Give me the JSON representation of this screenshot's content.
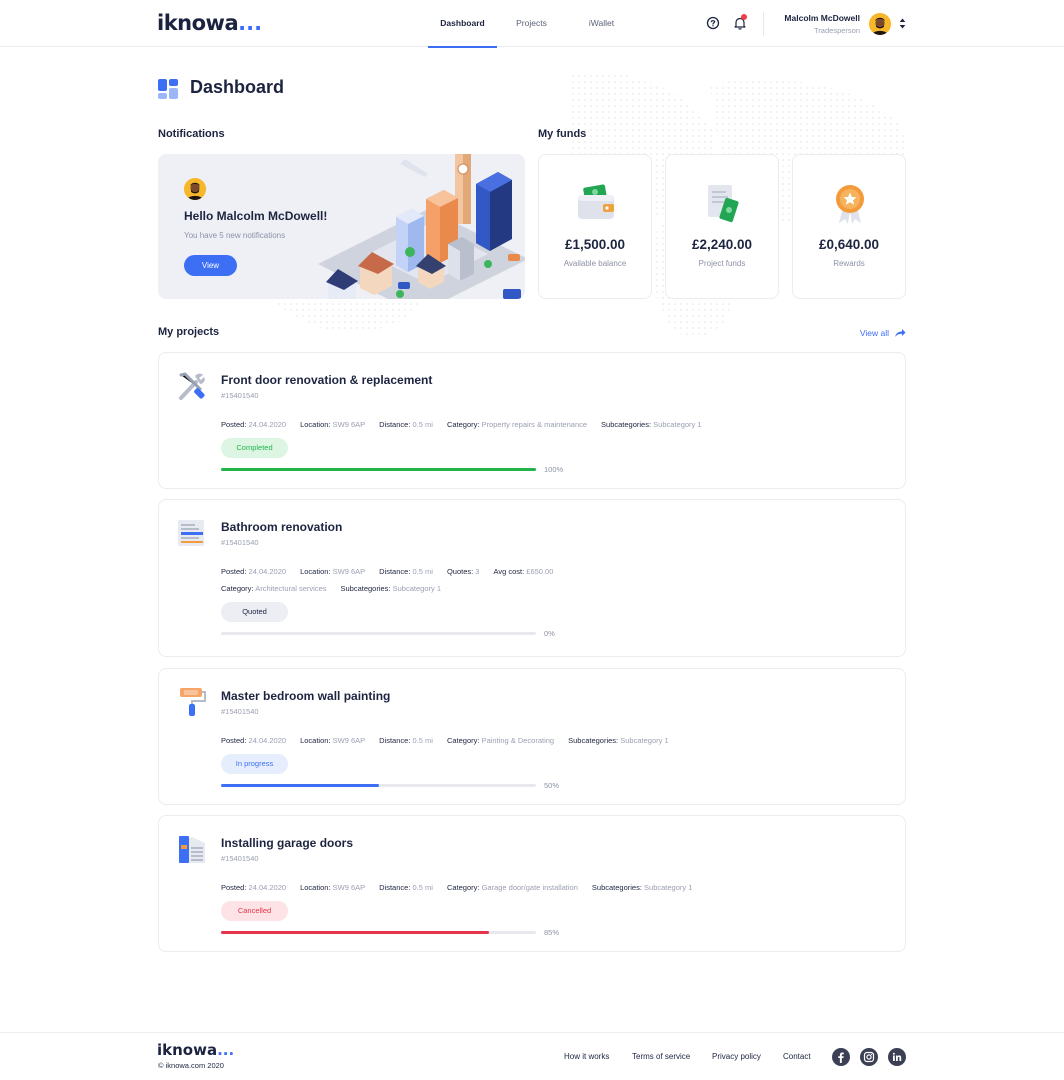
{
  "brand": {
    "name": "iknowa",
    "dots": "..."
  },
  "nav": {
    "tabs": [
      {
        "label": "Dashboard",
        "active": true
      },
      {
        "label": "Projects",
        "active": false
      },
      {
        "label": "iWallet",
        "active": false
      }
    ]
  },
  "user": {
    "name": "Malcolm McDowell",
    "role": "Tradesperson"
  },
  "page": {
    "title": "Dashboard"
  },
  "notifications": {
    "section_title": "Notifications",
    "greeting": "Hello Malcolm McDowell!",
    "subtitle": "You have 5 new notifications",
    "button_label": "View"
  },
  "funds": {
    "section_title": "My funds",
    "items": [
      {
        "amount": "£1,500.00",
        "label": "Available balance",
        "icon": "wallet-icon"
      },
      {
        "amount": "£2,240.00",
        "label": "Project funds",
        "icon": "document-money-icon"
      },
      {
        "amount": "£0,640.00",
        "label": "Rewards",
        "icon": "medal-icon"
      }
    ]
  },
  "projects": {
    "section_title": "My projects",
    "view_all": "View all",
    "items": [
      {
        "title": "Front door renovation & replacement",
        "id": "#15401540",
        "icon": "tools-icon",
        "meta_rows": [
          [
            {
              "k": "Posted:",
              "v": "24.04.2020"
            },
            {
              "k": "Location:",
              "v": "SW9 6AP"
            },
            {
              "k": "Distance:",
              "v": "0.5 mi"
            },
            {
              "k": "Category:",
              "v": "Property repairs & maintenance"
            },
            {
              "k": "Subcategories:",
              "v": "Subcategory 1"
            }
          ]
        ],
        "status": "Completed",
        "status_color": "#24b34b",
        "status_bg": "#dcf6e3",
        "progress": 100,
        "progress_label": "100%"
      },
      {
        "title": "Bathroom renovation",
        "id": "#15401540",
        "icon": "document-list-icon",
        "meta_rows": [
          [
            {
              "k": "Posted:",
              "v": "24.04.2020"
            },
            {
              "k": "Location:",
              "v": "SW9 6AP"
            },
            {
              "k": "Distance:",
              "v": "0.5 mi"
            },
            {
              "k": "Quotes:",
              "v": "3"
            },
            {
              "k": "Avg cost:",
              "v": "£650.00"
            }
          ],
          [
            {
              "k": "Category:",
              "v": "Architectural services"
            },
            {
              "k": "Subcategories:",
              "v": "Subcategory 1"
            }
          ]
        ],
        "status": "Quoted",
        "status_color": "#1d2440",
        "status_bg": "#eceef3",
        "progress": 0,
        "progress_label": "0%"
      },
      {
        "title": "Master bedroom wall painting",
        "id": "#15401540",
        "icon": "paint-roller-icon",
        "meta_rows": [
          [
            {
              "k": "Posted:",
              "v": "24.04.2020"
            },
            {
              "k": "Location:",
              "v": "SW9 6AP"
            },
            {
              "k": "Distance:",
              "v": "0.5 mi"
            },
            {
              "k": "Category:",
              "v": "Painting & Decorating"
            },
            {
              "k": "Subcategories:",
              "v": "Subcategory 1"
            }
          ]
        ],
        "status": "In progress",
        "status_color": "#3d6ff5",
        "status_bg": "#e6edfd",
        "progress": 50,
        "progress_label": "50%"
      },
      {
        "title": "Installing garage doors",
        "id": "#15401540",
        "icon": "garage-door-icon",
        "meta_rows": [
          [
            {
              "k": "Posted:",
              "v": "24.04.2020"
            },
            {
              "k": "Location:",
              "v": "SW9 6AP"
            },
            {
              "k": "Distance:",
              "v": "0.5 mi"
            },
            {
              "k": "Category:",
              "v": "Garage door/gate installation"
            },
            {
              "k": "Subcategories:",
              "v": "Subcategory 1"
            }
          ]
        ],
        "status": "Cancelled",
        "status_color": "#e5334a",
        "status_bg": "#fde3e6",
        "progress": 85,
        "progress_label": "85%"
      }
    ]
  },
  "footer": {
    "copyright": "© iknowa.com 2020",
    "links": [
      "How it works",
      "Terms of service",
      "Privacy policy",
      "Contact"
    ],
    "social": [
      "facebook-icon",
      "instagram-icon",
      "linkedin-icon"
    ]
  },
  "colors": {
    "accent": "#3d6ff5",
    "text": "#1d2440",
    "muted": "#9a9fb2"
  }
}
